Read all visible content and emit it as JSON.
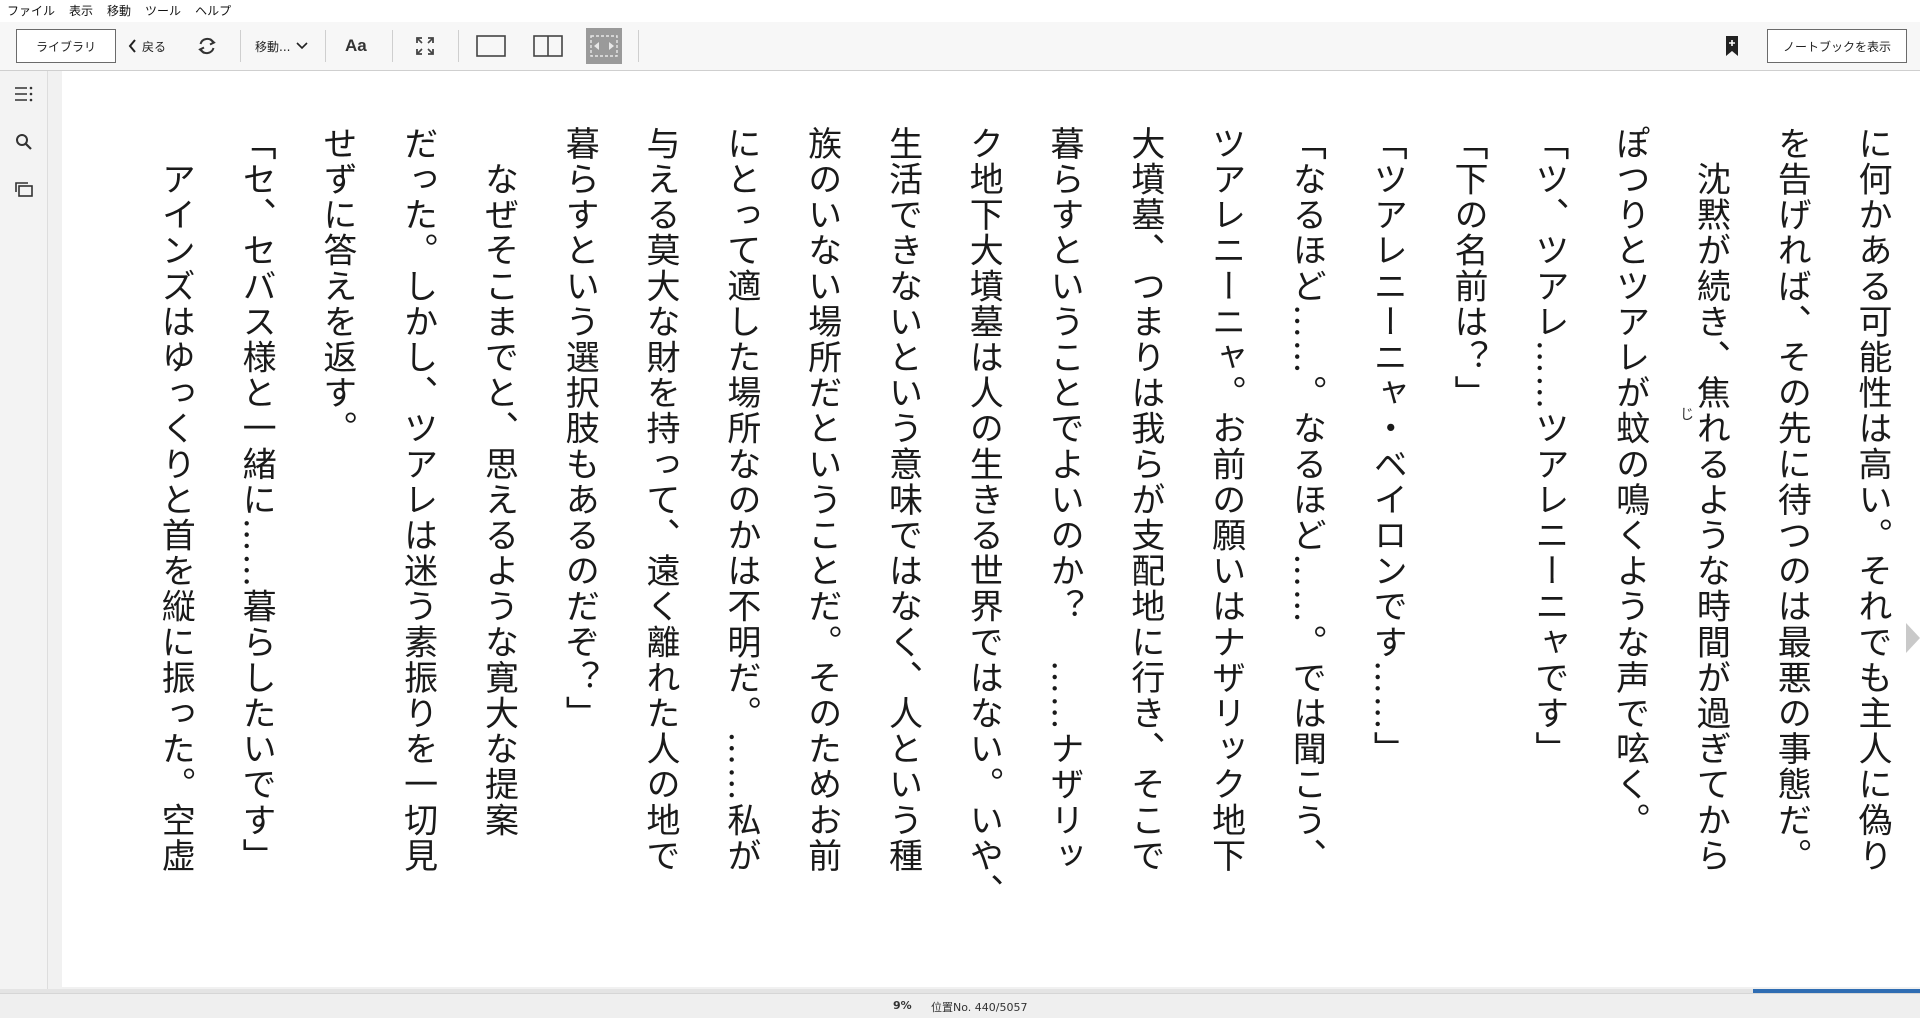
{
  "menu": [
    "ファイル",
    "表示",
    "移動",
    "ツール",
    "ヘルプ"
  ],
  "toolbar": {
    "library_label": "ライブラリ",
    "back_label": "戻る",
    "goto_label": "移動...",
    "font_label": "Aa",
    "notebook_label": "ノートブックを表示"
  },
  "book": {
    "lines": [
      "に何かある可能性は高い。それでも主人に偽り",
      "を告げれば、その先に待つのは最悪の事態だ。",
      "　沈黙が続き、焦れるような時間が過ぎてから",
      "ぽつりとツアレが蚊の鳴くような声で呟く。",
      "「ツ、ツアレ……ツアレニーニャです」",
      "「下の名前は？」",
      "「ツアレニーニャ・ベイロンです……」",
      "「なるほど……。なるほど……。では聞こう、",
      "ツアレニーニャ。お前の願いはナザリック地下",
      "大墳墓、つまりは我らが支配地に行き、そこで",
      "暮らすということでよいのか？　……ナザリッ",
      "ク地下大墳墓は人の生きる世界ではない。いや、",
      "生活できないという意味ではなく、人という種",
      "族のいない場所だということだ。そのためお前",
      "にとって適した場所なのかは不明だ。……私が",
      "与える莫大な財を持って、遠く離れた人の地で",
      "暮らすという選択肢もあるのだぞ？」",
      "　なぜそこまでと、思えるような寛大な提案",
      "だった。しかし、ツアレは迷う素振りを一切見",
      "せずに答えを返す。",
      "「セ、セバス様と一緒に……暮らしたいです」",
      "　アインズはゆっくりと首を縦に振った。空虚"
    ],
    "ruby": "じ"
  },
  "status": {
    "percent": "9%",
    "location": "位置No. 440/5057",
    "progress": 0.087
  },
  "colors": {
    "accent": "#2f6db3",
    "page_bg": "#ffffff"
  }
}
